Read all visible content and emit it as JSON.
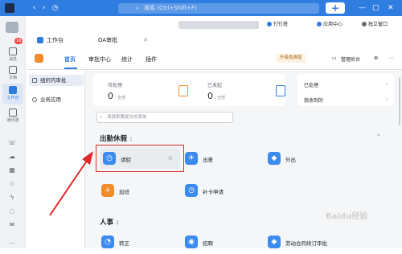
{
  "topbar": {
    "search_placeholder": "搜索 (Ctrl+Shift+F)",
    "plus": "+",
    "minimize": "—",
    "maximize": "□",
    "close": "✕"
  },
  "sidebar": {
    "badge": "18",
    "items": [
      {
        "label": "消息"
      },
      {
        "label": "文档"
      },
      {
        "label": "工作台"
      },
      {
        "label": "通讯录"
      }
    ]
  },
  "tabs": [
    {
      "label": "工作台",
      "icon_color": "#2f7de1"
    },
    {
      "label": "OA审批",
      "close": "✕"
    }
  ],
  "tab_right": [
    {
      "label": "钉钉搭"
    },
    {
      "label": "应用中心"
    },
    {
      "label": "独立窗口"
    }
  ],
  "header": {
    "nav": [
      "首页",
      "审批中心",
      "统计",
      "插件"
    ],
    "upgrade": "升级免费版",
    "admin": "管理后台"
  },
  "left_panel": [
    {
      "label": "组织内审批"
    },
    {
      "label": "业务应用"
    }
  ],
  "stats": [
    {
      "label": "待处理",
      "value": "0",
      "sub": "全部",
      "color": "#f08c2a"
    },
    {
      "label": "已发起",
      "value": "0",
      "sub": "全部",
      "color": "#2f7de1"
    }
  ],
  "links": [
    "已处理",
    "我收到的"
  ],
  "search_placeholder": "请搜索要提交的表单",
  "sections": [
    {
      "title": "出勤休假",
      "count": "1",
      "apps": [
        {
          "label": "请假",
          "color": "#3c8cf0"
        },
        {
          "label": "出差",
          "color": "#3c8cf0"
        },
        {
          "label": "外出",
          "color": "#3c8cf0"
        },
        {
          "label": "加班",
          "color": "#f08c2a"
        },
        {
          "label": "补卡申请",
          "color": "#3c8cf0"
        }
      ]
    },
    {
      "title": "人事",
      "count": "3",
      "apps": [
        {
          "label": "转正",
          "color": "#3c8cf0"
        },
        {
          "label": "招聘",
          "color": "#3c8cf0"
        },
        {
          "label": "劳动合同续订审批",
          "color": "#3c8cf0"
        }
      ]
    }
  ],
  "watermark": "Baidu经验",
  "accent": "#2f7de1",
  "highlight_color": "#e02a2a"
}
